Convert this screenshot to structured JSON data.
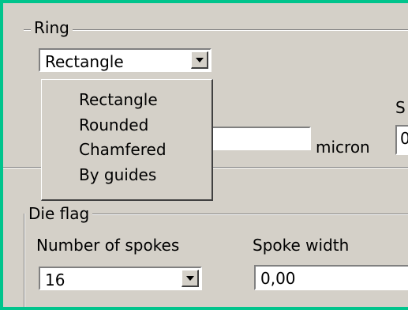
{
  "ring": {
    "legend": "Ring",
    "shape_select": {
      "value": "Rectangle"
    },
    "shape_options": [
      "Rectangle",
      "Rounded",
      "Chamfered",
      "By guides"
    ],
    "value_field": {
      "value": ""
    },
    "unit_label": "micron",
    "right_label_partial": "S",
    "right_field_partial": "0"
  },
  "die_flag": {
    "legend": "Die flag",
    "spokes_label": "Number of spokes",
    "spokes_select": {
      "value": "16"
    },
    "spoke_width_label": "Spoke width",
    "spoke_width_field": {
      "value": "0,00"
    }
  },
  "colors": {
    "window_border": "#00c48c",
    "panel_bg": "#d4d0c8",
    "field_bg": "#ffffff"
  }
}
